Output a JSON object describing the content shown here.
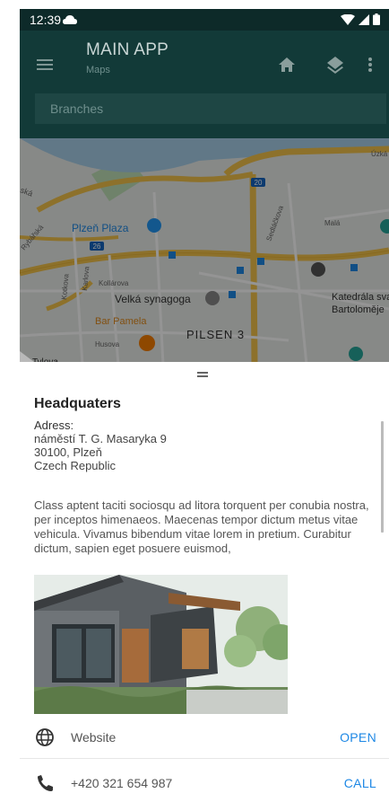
{
  "status_bar": {
    "time": "12:39"
  },
  "app_bar": {
    "title": "MAIN APP",
    "subtitle": "Maps",
    "search_placeholder": "Branches",
    "background_color": "#123a38"
  },
  "map": {
    "labels": {
      "plzen_plaza": "Plzeň Plaza",
      "velka_synagoga": "Velká synagoga",
      "bar_pamela": "Bar Pamela",
      "pilsen_3": "PILSEN 3",
      "katedrala_1": "Katedrála svat",
      "katedrala_2": "Bartoloměje",
      "kollarova": "Kollárova",
      "husova": "Husova",
      "mala": "Malá",
      "sedlackova": "Sedláčkova",
      "karlova": "Karlova",
      "kotkova": "Kotkova",
      "rybarska": "Rybářská",
      "tylova": "Tylova",
      "uzka": "Úzká",
      "ska": "ská",
      "route_20": "20",
      "route_26": "26"
    }
  },
  "sheet": {
    "title": "Headquaters",
    "address_label": "Adress",
    "address_colon": ":",
    "address_line1": "náměstí T. G. Masaryka 9",
    "address_line2": "30100, Plzeň",
    "address_line3": "Czech Republic",
    "description": "Class aptent taciti sociosqu ad litora torquent per conubia nostra, per inceptos himenaeos. Maecenas tempor dictum metus vitae vehicula. Vivamus bibendum vitae lorem in pretium. Curabitur dictum, sapien eget posuere euismod,",
    "website": {
      "label": "Website",
      "action": "OPEN"
    },
    "phone": {
      "label": "+420 321 654 987",
      "action": "CALL"
    },
    "accent_color": "#1e88e5"
  }
}
